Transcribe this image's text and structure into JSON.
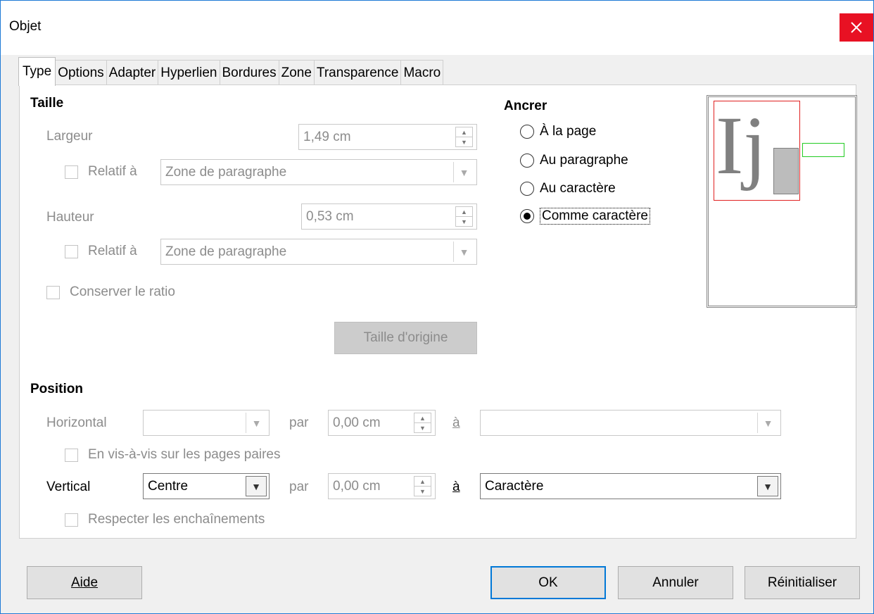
{
  "window": {
    "title": "Objet"
  },
  "tabs": [
    "Type",
    "Options",
    "Adapter",
    "Hyperlien",
    "Bordures",
    "Zone",
    "Transparence",
    "Macro"
  ],
  "size": {
    "title": "Taille",
    "width_label": "Largeur",
    "width_value": "1,49 cm",
    "relative_label": "Relatif à",
    "relative_width_value": "Zone de paragraphe",
    "height_label": "Hauteur",
    "height_value": "0,53 cm",
    "relative_height_value": "Zone de paragraphe",
    "keep_ratio_label": "Conserver le ratio",
    "original_size_button": "Taille d'origine"
  },
  "anchor": {
    "title": "Ancrer",
    "options": [
      "À la page",
      "Au paragraphe",
      "Au caractère",
      "Comme caractère"
    ],
    "selected": "Comme caractère"
  },
  "preview": {
    "glyphs": "Ij"
  },
  "position": {
    "title": "Position",
    "horizontal_label": "Horizontal",
    "horizontal_value": "",
    "by_label": "par",
    "horizontal_by_value": "0,00 cm",
    "to_label": "à",
    "horizontal_to_value": "",
    "mirror_label": "En vis-à-vis sur les pages paires",
    "vertical_label": "Vertical",
    "vertical_value": "Centre",
    "vertical_by_value": "0,00 cm",
    "vertical_to_value": "Caractère",
    "follow_flow_label": "Respecter les enchaînements"
  },
  "buttons": {
    "help": "Aide",
    "ok": "OK",
    "cancel": "Annuler",
    "reset": "Réinitialiser"
  },
  "colors": {
    "accent": "#0078d7",
    "close": "#e81123",
    "preview_frame": "#e02020",
    "preview_marker": "#22cc22"
  }
}
